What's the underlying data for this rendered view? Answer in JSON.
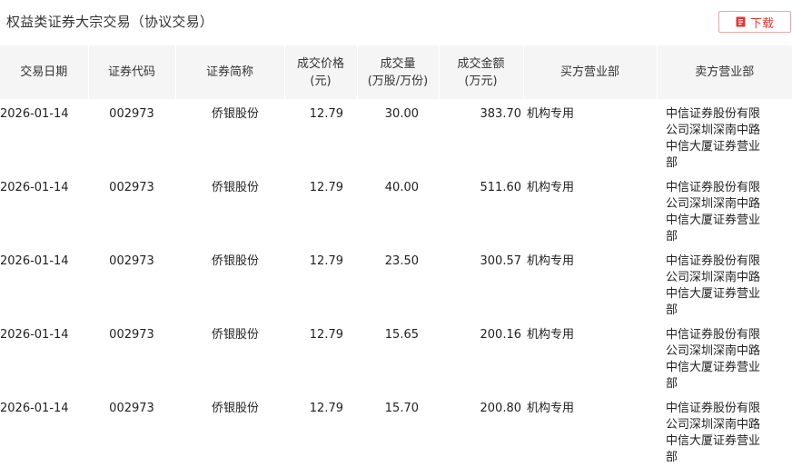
{
  "header": {
    "title": "权益类证券大宗交易（协议交易）",
    "download_label": "下载",
    "download_icon": "document-icon",
    "accent": "#e03a3a"
  },
  "table": {
    "columns": [
      {
        "l1": "交易日期",
        "l2": ""
      },
      {
        "l1": "证券代码",
        "l2": ""
      },
      {
        "l1": "证券简称",
        "l2": ""
      },
      {
        "l1": "成交价格",
        "l2": "(元)"
      },
      {
        "l1": "成交量",
        "l2": "(万股/万份)"
      },
      {
        "l1": "成交金额",
        "l2": "(万元)"
      },
      {
        "l1": "买方营业部",
        "l2": ""
      },
      {
        "l1": "卖方营业部",
        "l2": ""
      }
    ],
    "rows": [
      {
        "date": "2026-01-14",
        "code": "002973",
        "name": "侨银股份",
        "price": "12.79",
        "volume": "30.00",
        "amount": "383.70",
        "buyer": "机构专用",
        "seller": "中信证券股份有限公司深圳深南中路中信大厦证券营业部"
      },
      {
        "date": "2026-01-14",
        "code": "002973",
        "name": "侨银股份",
        "price": "12.79",
        "volume": "40.00",
        "amount": "511.60",
        "buyer": "机构专用",
        "seller": "中信证券股份有限公司深圳深南中路中信大厦证券营业部"
      },
      {
        "date": "2026-01-14",
        "code": "002973",
        "name": "侨银股份",
        "price": "12.79",
        "volume": "23.50",
        "amount": "300.57",
        "buyer": "机构专用",
        "seller": "中信证券股份有限公司深圳深南中路中信大厦证券营业部"
      },
      {
        "date": "2026-01-14",
        "code": "002973",
        "name": "侨银股份",
        "price": "12.79",
        "volume": "15.65",
        "amount": "200.16",
        "buyer": "机构专用",
        "seller": "中信证券股份有限公司深圳深南中路中信大厦证券营业部"
      },
      {
        "date": "2026-01-14",
        "code": "002973",
        "name": "侨银股份",
        "price": "12.79",
        "volume": "15.70",
        "amount": "200.80",
        "buyer": "机构专用",
        "seller": "中信证券股份有限公司深圳深南中路中信大厦证券营业部"
      }
    ]
  }
}
